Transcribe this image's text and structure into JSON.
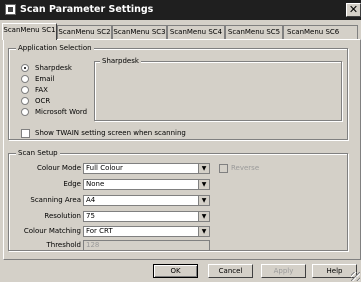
{
  "window": {
    "title": "Scan Parameter Settings",
    "close_glyph": "✕"
  },
  "tabs": [
    {
      "label": "ScanMenu SC1",
      "active": true
    },
    {
      "label": "ScanMenu SC2",
      "active": false
    },
    {
      "label": "ScanMenu SC3",
      "active": false
    },
    {
      "label": "ScanMenu SC4",
      "active": false
    },
    {
      "label": "ScanMenu SC5",
      "active": false
    },
    {
      "label": "ScanMenu SC6",
      "active": false
    }
  ],
  "app_selection": {
    "legend": "Application Selection",
    "options": [
      {
        "label": "Sharpdesk",
        "selected": true
      },
      {
        "label": "Email",
        "selected": false
      },
      {
        "label": "FAX",
        "selected": false
      },
      {
        "label": "OCR",
        "selected": false
      },
      {
        "label": "Microsoft Word",
        "selected": false
      }
    ],
    "sub_legend": "Sharpdesk"
  },
  "twain_checkbox": {
    "label": "Show TWAIN setting screen when scanning",
    "checked": false
  },
  "scan_setup": {
    "legend": "Scan Setup",
    "colour_mode": {
      "label": "Colour Mode",
      "value": "Full Colour"
    },
    "edge": {
      "label": "Edge",
      "value": "None"
    },
    "scanning_area": {
      "label": "Scanning Area",
      "value": "A4"
    },
    "resolution": {
      "label": "Resolution",
      "value": "75"
    },
    "colour_matching": {
      "label": "Colour Matching",
      "value": "For CRT"
    },
    "threshold": {
      "label": "Threshold",
      "value": "128"
    },
    "reverse": {
      "label": "Reverse",
      "checked": false
    }
  },
  "buttons": {
    "ok": "OK",
    "cancel": "Cancel",
    "apply": "Apply",
    "help": "Help"
  }
}
